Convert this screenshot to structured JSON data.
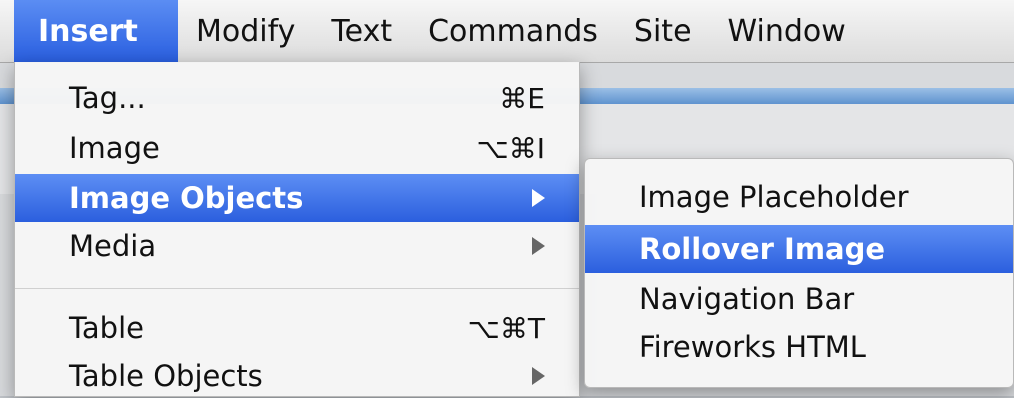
{
  "menubar": {
    "items": [
      {
        "label": "Insert",
        "active": true
      },
      {
        "label": "Modify"
      },
      {
        "label": "Text"
      },
      {
        "label": "Commands"
      },
      {
        "label": "Site"
      },
      {
        "label": "Window"
      }
    ]
  },
  "insert_menu": {
    "items": [
      {
        "label": "Tag...",
        "shortcut": "⌘E"
      },
      {
        "label": "Image",
        "shortcut": "⌥⌘I"
      },
      {
        "label": "Image Objects",
        "submenu": true,
        "highlighted": true
      },
      {
        "label": "Media",
        "submenu": true
      },
      {
        "label": "Table",
        "shortcut": "⌥⌘T"
      },
      {
        "label": "Table Objects",
        "submenu": true
      }
    ]
  },
  "image_objects_submenu": {
    "items": [
      {
        "label": "Image Placeholder"
      },
      {
        "label": "Rollover Image",
        "highlighted": true
      },
      {
        "label": "Navigation Bar"
      },
      {
        "label": "Fireworks HTML"
      }
    ]
  },
  "icons": {
    "submenu_arrow": "chevron-right-icon"
  },
  "colors": {
    "highlight": "#3a6fe6",
    "menu_bg": "#f5f5f5"
  }
}
